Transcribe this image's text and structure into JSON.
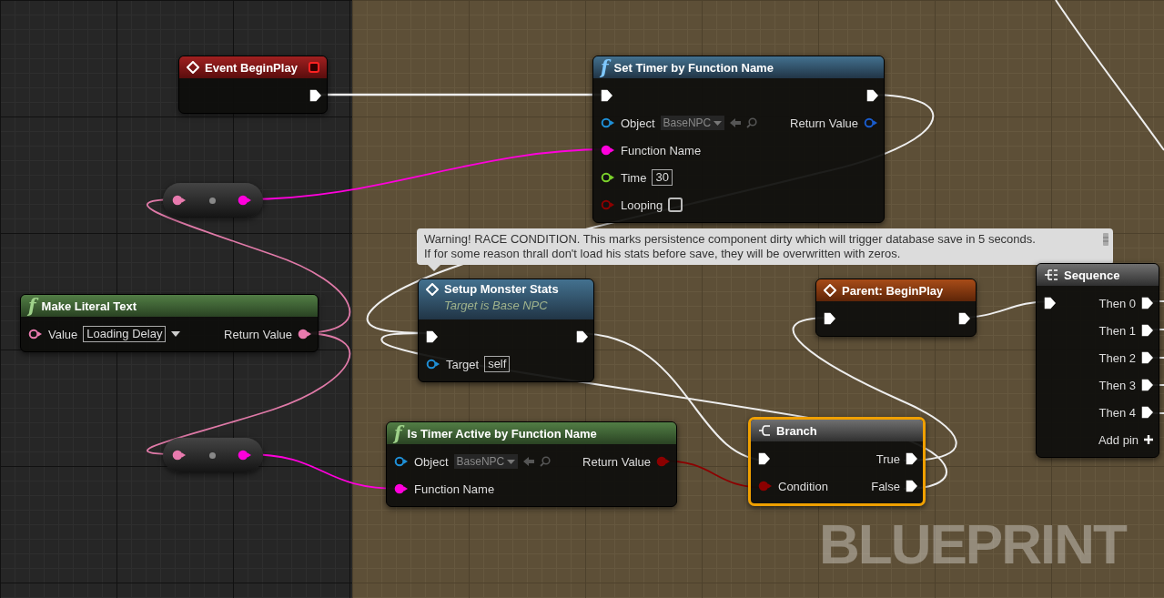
{
  "nodes": [
    {
      "kind": "event",
      "title": "Event BeginPlay",
      "selected": false,
      "pins_right": [
        {
          "kind": "exec",
          "connected": true
        }
      ]
    },
    {
      "kind": "function",
      "glyph": "f",
      "title": "Set Timer by Function Name",
      "selected": false,
      "pins_left": [
        {
          "kind": "exec",
          "connected": true
        },
        {
          "kind": "data",
          "label": "Object",
          "color": "#1f8fd6",
          "connected": false,
          "field": {
            "kind": "object-picker",
            "value": "BaseNPC"
          }
        },
        {
          "kind": "data",
          "label": "Function Name",
          "color": "#ff00dc",
          "connected": true
        },
        {
          "kind": "data",
          "label": "Time",
          "color": "#7bd12b",
          "connected": false,
          "field": {
            "kind": "text-box",
            "value": "30"
          }
        },
        {
          "kind": "data",
          "label": "Looping",
          "color": "#8c0000",
          "connected": false,
          "field": {
            "kind": "checkbox",
            "checked": false
          }
        }
      ],
      "pins_right": [
        {
          "kind": "exec",
          "connected": true
        },
        {
          "kind": "data",
          "label": "Return Value",
          "color": "#1a5ccc",
          "connected": false
        }
      ]
    },
    {
      "kind": "reroute",
      "selected": false,
      "pins_left": [
        {
          "kind": "data",
          "color": "#e87aae",
          "connected": true
        }
      ],
      "pins_right": [
        {
          "kind": "data",
          "color": "#ff00dc",
          "connected": true
        }
      ]
    },
    {
      "kind": "pure-function",
      "glyph": "f",
      "title": "Make Literal Text",
      "selected": false,
      "pins_left": [
        {
          "kind": "data",
          "label": "Value",
          "color": "#e87aae",
          "connected": false,
          "field": {
            "kind": "text-box",
            "value": "Loading Delay",
            "dropdown": true
          }
        }
      ],
      "pins_right": [
        {
          "kind": "data",
          "label": "Return Value",
          "color": "#e87aae",
          "connected": true
        }
      ]
    },
    {
      "kind": "event-call",
      "title": "Setup Monster Stats",
      "subtitle": "Target is Base NPC",
      "selected": false,
      "comment": "Warning! RACE CONDITION. This marks persistence component dirty which will trigger database save in 5 seconds.\nIf for some reason thrall don't load his stats before save, they will be overwritten with zeros.",
      "pins_left": [
        {
          "kind": "exec",
          "connected": true
        },
        {
          "kind": "data",
          "label": "Target",
          "color": "#1f8fd6",
          "connected": false,
          "field": {
            "kind": "text-box",
            "value": "self"
          }
        }
      ],
      "pins_right": [
        {
          "kind": "exec",
          "connected": true
        }
      ]
    },
    {
      "kind": "parent-event",
      "title": "Parent: BeginPlay",
      "selected": false,
      "pins_left": [
        {
          "kind": "exec",
          "connected": true
        }
      ],
      "pins_right": [
        {
          "kind": "exec",
          "connected": true
        }
      ]
    },
    {
      "kind": "sequence",
      "title": "Sequence",
      "selected": false,
      "add_pin": "Add pin",
      "pins_left": [
        {
          "kind": "exec",
          "connected": true
        }
      ],
      "pins_right": [
        {
          "kind": "exec",
          "label": "Then 0",
          "connected": true
        },
        {
          "kind": "exec",
          "label": "Then 1",
          "connected": true
        },
        {
          "kind": "exec",
          "label": "Then 2",
          "connected": true
        },
        {
          "kind": "exec",
          "label": "Then 3",
          "connected": true
        },
        {
          "kind": "exec",
          "label": "Then 4",
          "connected": true
        }
      ]
    },
    {
      "kind": "pure-function",
      "glyph": "f",
      "title": "Is Timer Active by Function Name",
      "selected": false,
      "pins_left": [
        {
          "kind": "data",
          "label": "Object",
          "color": "#1f8fd6",
          "connected": false,
          "field": {
            "kind": "object-picker",
            "value": "BaseNPC"
          }
        },
        {
          "kind": "data",
          "label": "Function Name",
          "color": "#ff00dc",
          "connected": true
        }
      ],
      "pins_right": [
        {
          "kind": "data",
          "label": "Return Value",
          "color": "#8c0000",
          "connected": true
        }
      ]
    },
    {
      "kind": "branch",
      "title": "Branch",
      "selected": true,
      "pins_left": [
        {
          "kind": "exec",
          "connected": true
        },
        {
          "kind": "data",
          "label": "Condition",
          "color": "#8c0000",
          "connected": true
        }
      ],
      "pins_right": [
        {
          "kind": "exec",
          "label": "True",
          "connected": true
        },
        {
          "kind": "exec",
          "label": "False",
          "connected": true
        }
      ]
    },
    {
      "kind": "reroute",
      "selected": false,
      "pins_left": [
        {
          "kind": "data",
          "color": "#e87aae",
          "connected": true
        }
      ],
      "pins_right": [
        {
          "kind": "data",
          "color": "#ff00dc",
          "connected": true
        }
      ]
    }
  ],
  "graph_label": "BLUEPRINT"
}
